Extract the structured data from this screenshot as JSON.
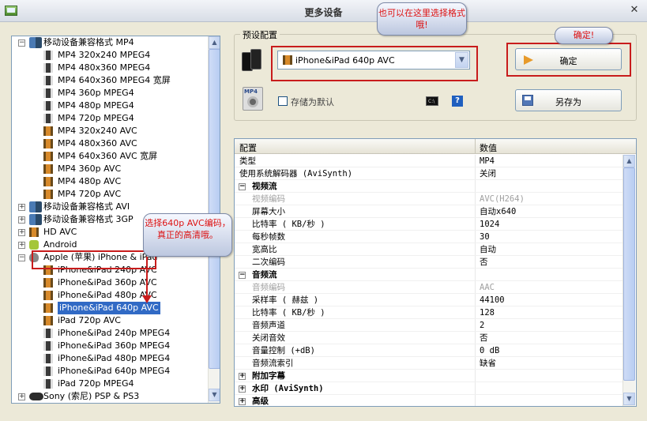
{
  "window": {
    "title": "更多设备",
    "close": "✕"
  },
  "tree": {
    "items": [
      {
        "label": "移动设备兼容格式 MP4",
        "level": 0,
        "expanded": true,
        "icon": "device-icon"
      },
      {
        "label": "MP4 320x240 MPEG4",
        "level": 1,
        "icon": "film-icon"
      },
      {
        "label": "MP4 480x360 MPEG4",
        "level": 1,
        "icon": "film-icon"
      },
      {
        "label": "MP4 640x360 MPEG4 宽屏",
        "level": 1,
        "icon": "film-icon"
      },
      {
        "label": "MP4 360p MPEG4",
        "level": 1,
        "icon": "film-icon"
      },
      {
        "label": "MP4 480p MPEG4",
        "level": 1,
        "icon": "film-icon"
      },
      {
        "label": "MP4 720p MPEG4",
        "level": 1,
        "icon": "film-icon"
      },
      {
        "label": "MP4 320x240 AVC",
        "level": 1,
        "icon": "film-icon-orange"
      },
      {
        "label": "MP4 480x360 AVC",
        "level": 1,
        "icon": "film-icon-orange"
      },
      {
        "label": "MP4 640x360 AVC 宽屏",
        "level": 1,
        "icon": "film-icon-orange"
      },
      {
        "label": "MP4 360p AVC",
        "level": 1,
        "icon": "film-icon-orange"
      },
      {
        "label": "MP4 480p AVC",
        "level": 1,
        "icon": "film-icon-orange"
      },
      {
        "label": "MP4 720p AVC",
        "level": 1,
        "icon": "film-icon-orange"
      },
      {
        "label": "移动设备兼容格式 AVI",
        "level": 0,
        "expanded": false,
        "icon": "device-icon"
      },
      {
        "label": "移动设备兼容格式 3GP",
        "level": 0,
        "expanded": false,
        "icon": "device-icon"
      },
      {
        "label": "HD AVC",
        "level": 0,
        "expanded": false,
        "icon": "film-icon-orange"
      },
      {
        "label": "Android",
        "level": 0,
        "expanded": false,
        "icon": "android-icon"
      },
      {
        "label": "Apple (苹果) iPhone & iPad",
        "level": 0,
        "expanded": true,
        "icon": "apple-icon"
      },
      {
        "label": "iPhone&iPad 240p AVC",
        "level": 1,
        "icon": "film-icon-orange"
      },
      {
        "label": "iPhone&iPad 360p AVC",
        "level": 1,
        "icon": "film-icon-orange"
      },
      {
        "label": "iPhone&iPad 480p AVC",
        "level": 1,
        "icon": "film-icon-orange"
      },
      {
        "label": "iPhone&iPad 640p AVC",
        "level": 1,
        "icon": "film-icon-orange",
        "selected": true
      },
      {
        "label": "iPad 720p AVC",
        "level": 1,
        "icon": "film-icon-orange"
      },
      {
        "label": "iPhone&iPad 240p MPEG4",
        "level": 1,
        "icon": "film-icon"
      },
      {
        "label": "iPhone&iPad 360p MPEG4",
        "level": 1,
        "icon": "film-icon"
      },
      {
        "label": "iPhone&iPad 480p MPEG4",
        "level": 1,
        "icon": "film-icon"
      },
      {
        "label": "iPhone&iPad 640p MPEG4",
        "level": 1,
        "icon": "film-icon"
      },
      {
        "label": "iPad 720p MPEG4",
        "level": 1,
        "icon": "film-icon"
      },
      {
        "label": "Sony (索尼) PSP & PS3",
        "level": 0,
        "expanded": false,
        "icon": "psp-icon"
      }
    ]
  },
  "preset": {
    "group_label": "预设配置",
    "selected": "iPhone&iPad 640p AVC",
    "save_default_label": "存储为默认",
    "ok_label": "确定",
    "save_as_label": "另存为",
    "cmd_label": "C:\\",
    "help_label": "?"
  },
  "grid": {
    "col_key": "配置",
    "col_value": "数值",
    "rows": [
      {
        "k": "类型",
        "v": "MP4",
        "kind": "row"
      },
      {
        "k": "使用系统解码器 (AviSynth)",
        "v": "关闭",
        "kind": "row"
      },
      {
        "k": "视频流",
        "v": "",
        "kind": "cat",
        "toggle": "−"
      },
      {
        "k": "视频编码",
        "v": "AVC(H264)",
        "kind": "dis"
      },
      {
        "k": "屏幕大小",
        "v": "自动x640",
        "kind": "sub"
      },
      {
        "k": "比特率 ( KB/秒 )",
        "v": "1024",
        "kind": "sub"
      },
      {
        "k": "每秒帧数",
        "v": "30",
        "kind": "sub"
      },
      {
        "k": "宽高比",
        "v": "自动",
        "kind": "sub"
      },
      {
        "k": "二次编码",
        "v": "否",
        "kind": "sub"
      },
      {
        "k": "音频流",
        "v": "",
        "kind": "cat",
        "toggle": "−"
      },
      {
        "k": "音频编码",
        "v": "AAC",
        "kind": "dis"
      },
      {
        "k": "采样率 ( 赫兹 )",
        "v": "44100",
        "kind": "sub"
      },
      {
        "k": "比特率 ( KB/秒 )",
        "v": "128",
        "kind": "sub"
      },
      {
        "k": "音频声道",
        "v": "2",
        "kind": "sub"
      },
      {
        "k": "关闭音效",
        "v": "否",
        "kind": "sub"
      },
      {
        "k": "音量控制 (+dB)",
        "v": "0 dB",
        "kind": "sub"
      },
      {
        "k": "音频流索引",
        "v": "缺省",
        "kind": "sub"
      },
      {
        "k": "附加字幕",
        "v": "",
        "kind": "cat",
        "toggle": "+"
      },
      {
        "k": "水印 (AviSynth)",
        "v": "",
        "kind": "cat",
        "toggle": "+"
      },
      {
        "k": "高级",
        "v": "",
        "kind": "cat",
        "toggle": "+"
      }
    ]
  },
  "annotations": {
    "preset_tip": "也可以在这里选择格式哦!",
    "ok_tip": "确定!",
    "tree_tip": "选择640p AVC编码，真正的高清哦。"
  },
  "colors": {
    "annotation_red": "#c81c1c",
    "selection_blue": "#316ac5"
  }
}
